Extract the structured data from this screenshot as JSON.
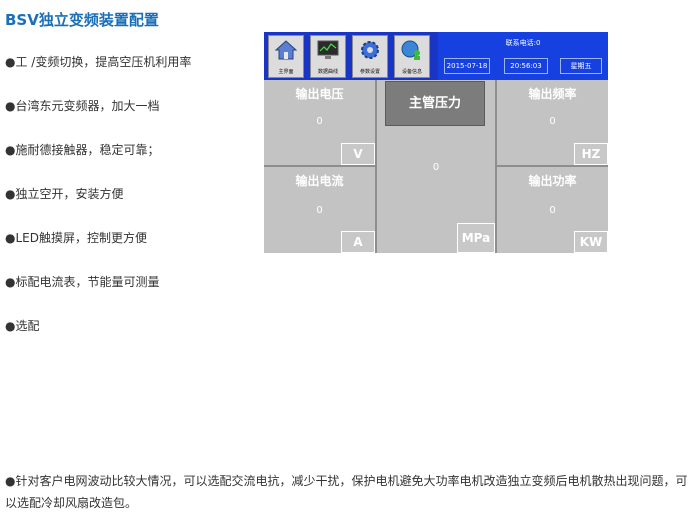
{
  "title": "BSV独立变频装置配置",
  "features": [
    "●工 /变频切换，提高空压机利用率",
    "●台湾东元变频器，加大一档",
    "●施耐德接触器，稳定可靠；",
    "●独立空开，安装方便",
    "●LED触摸屏，控制更方便",
    "●标配电流表，节能量可测量",
    "●选配"
  ],
  "note": "●针对客户电网波动比较大情况，可以选配交流电抗，减少干扰，保护电机避免大功率电机改造独立变频后电机散热出现问题，可以选配冷却风扇改造包。",
  "hmi": {
    "nav": [
      {
        "label": "主界面",
        "icon": "home-icon"
      },
      {
        "label": "数据曲线",
        "icon": "monitor-chart-icon"
      },
      {
        "label": "参数设置",
        "icon": "gear-icon"
      },
      {
        "label": "设备信息",
        "icon": "globe-user-icon"
      }
    ],
    "phone": "联系电话:0",
    "date": "2015-07-18",
    "time": "20:56:03",
    "weekday": "星期五",
    "cells": {
      "voltage": {
        "title": "输出电压",
        "value": "0",
        "unit": "V"
      },
      "pressure": {
        "title": "主管压力",
        "value": "0",
        "unit": "MPa"
      },
      "frequency": {
        "title": "输出频率",
        "value": "0",
        "unit": "HZ"
      },
      "current": {
        "title": "输出电流",
        "value": "0",
        "unit": "A"
      },
      "power": {
        "title": "输出功率",
        "value": "0",
        "unit": "KW"
      }
    }
  }
}
